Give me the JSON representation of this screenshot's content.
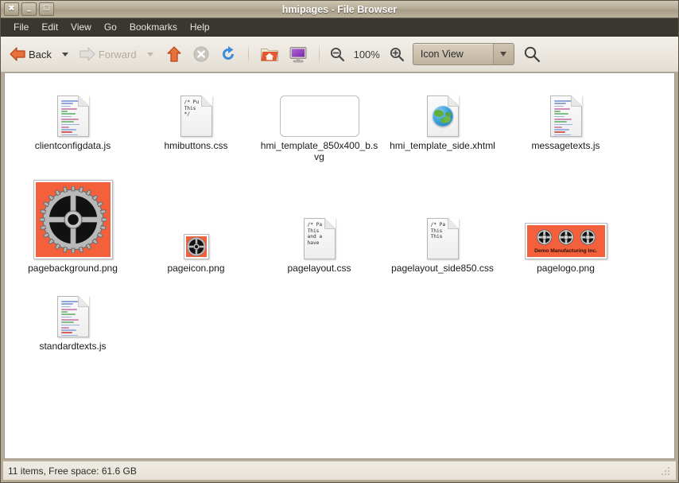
{
  "window": {
    "title": "hmipages - File Browser",
    "buttons": [
      {
        "name": "close",
        "glyph": "✖"
      },
      {
        "name": "minimize",
        "glyph": "–"
      },
      {
        "name": "maximize",
        "glyph": "□"
      }
    ]
  },
  "menubar": {
    "items": [
      "File",
      "Edit",
      "View",
      "Go",
      "Bookmarks",
      "Help"
    ]
  },
  "toolbar": {
    "back_label": "Back",
    "forward_label": "Forward",
    "zoom_level": "100%",
    "view_mode": "Icon View",
    "icons": {
      "back": "back-arrow-icon",
      "forward": "forward-arrow-icon",
      "up": "up-arrow-icon",
      "stop": "stop-icon",
      "reload": "reload-icon",
      "home": "home-folder-icon",
      "computer": "computer-icon",
      "zoom_out": "zoom-out-icon",
      "zoom_in": "zoom-in-icon",
      "search": "search-icon"
    }
  },
  "files": [
    {
      "name": "clientconfigdata.js",
      "kind": "js"
    },
    {
      "name": "hmibuttons.css",
      "kind": "css",
      "preview": "/* Pu\nThis\n*/"
    },
    {
      "name": "hmi_template_850x400_b.svg",
      "kind": "svg"
    },
    {
      "name": "hmi_template_side.xhtml",
      "kind": "xhtml"
    },
    {
      "name": "messagetexts.js",
      "kind": "js"
    },
    {
      "name": "pagebackground.png",
      "kind": "img-gear-large"
    },
    {
      "name": "pageicon.png",
      "kind": "img-gear-small"
    },
    {
      "name": "pagelayout.css",
      "kind": "css",
      "preview": "/* Pa\nThis\nand a\nhave"
    },
    {
      "name": "pagelayout_side850.css",
      "kind": "css",
      "preview": "/* Pa\nThis\nThis"
    },
    {
      "name": "pagelogo.png",
      "kind": "img-logo",
      "logo_text": "Demo Manufacturing Inc."
    },
    {
      "name": "standardtexts.js",
      "kind": "js"
    }
  ],
  "statusbar": {
    "text": "11 items, Free space: 61.6 GB"
  },
  "colors": {
    "accent_orange": "#f4603c",
    "titlebar": "#b6ac96",
    "menubar": "#3a3733",
    "pane_bg": "#ffffff"
  }
}
